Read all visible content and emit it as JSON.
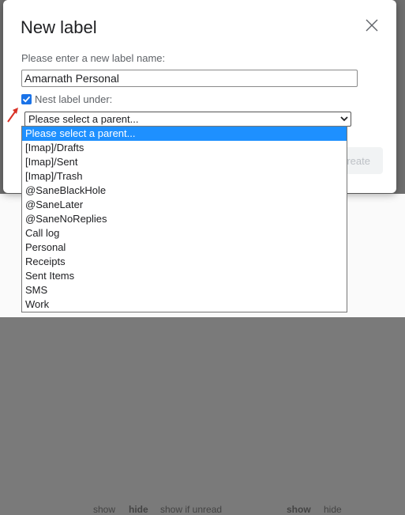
{
  "dialog": {
    "title": "New label",
    "prompt": "Please enter a new label name:",
    "name_value": "Amarnath Personal",
    "nest_checked": true,
    "nest_label": "Nest label under:",
    "parent_select": {
      "value": "Please select a parent...",
      "options": [
        "Please select a parent...",
        "[Imap]/Drafts",
        "[Imap]/Sent",
        "[Imap]/Trash",
        "@SaneBlackHole",
        "@SaneLater",
        "@SaneNoReplies",
        "Call log",
        "Personal",
        "Receipts",
        "Sent Items",
        "SMS",
        "Work"
      ]
    },
    "create_label": "Create"
  },
  "background": {
    "row": [
      "show",
      "hide",
      "show if unread",
      "show",
      "hide"
    ]
  },
  "colors": {
    "accent": "#1a73e8",
    "selected_option": "#1e90ff",
    "annotation_arrow": "#d93025"
  }
}
